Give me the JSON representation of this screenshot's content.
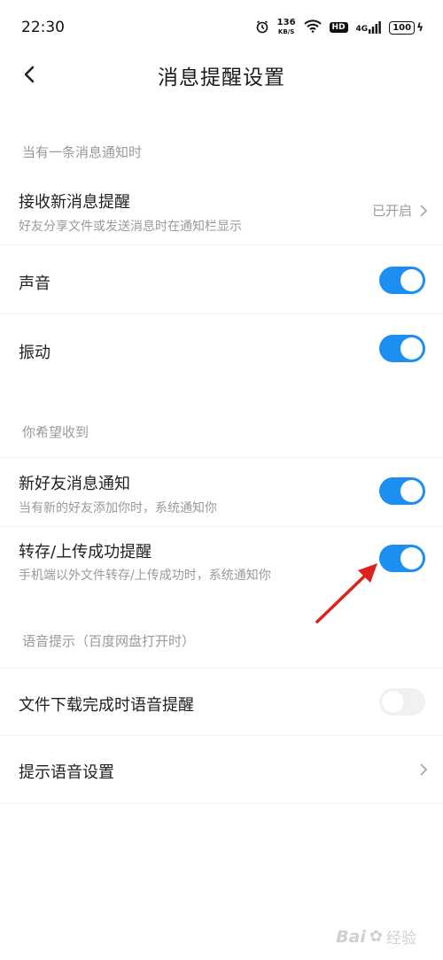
{
  "status_bar": {
    "time": "22:30",
    "speed_value": "136",
    "speed_unit": "KB/S",
    "hd": "HD",
    "network": "4G",
    "battery": "100",
    "icons": [
      "alarm-icon",
      "wifi-icon",
      "signal-icon",
      "battery-icon",
      "charging-icon"
    ]
  },
  "nav": {
    "title": "消息提醒设置",
    "back_icon": "chevron-left-icon"
  },
  "sections": [
    {
      "header": "当有一条消息通知时",
      "rows": [
        {
          "title": "接收新消息提醒",
          "subtitle": "好友分享文件或发送消息时在通知栏显示",
          "value": "已开启",
          "control": "link"
        },
        {
          "title": "声音",
          "control": "toggle",
          "on": true
        },
        {
          "title": "振动",
          "control": "toggle",
          "on": true
        }
      ]
    },
    {
      "header": "你希望收到",
      "rows": [
        {
          "title": "新好友消息通知",
          "subtitle": "当有新的好友添加你时，系统通知你",
          "control": "toggle",
          "on": true
        },
        {
          "title": "转存/上传成功提醒",
          "subtitle": "手机端以外文件转存/上传成功时，系统通知你",
          "control": "toggle",
          "on": true
        }
      ]
    },
    {
      "header": "语音提示（百度网盘打开时）",
      "rows": [
        {
          "title": "文件下载完成时语音提醒",
          "control": "toggle",
          "on": false
        },
        {
          "title": "提示语音设置",
          "control": "link"
        }
      ]
    }
  ],
  "colors": {
    "toggle_on": "#1e8ff2",
    "toggle_off": "#f1f1f1",
    "annotation_arrow": "#e0201e",
    "secondary_text": "#999999"
  },
  "watermark": {
    "text": "Bai",
    "suffix": "经验"
  }
}
